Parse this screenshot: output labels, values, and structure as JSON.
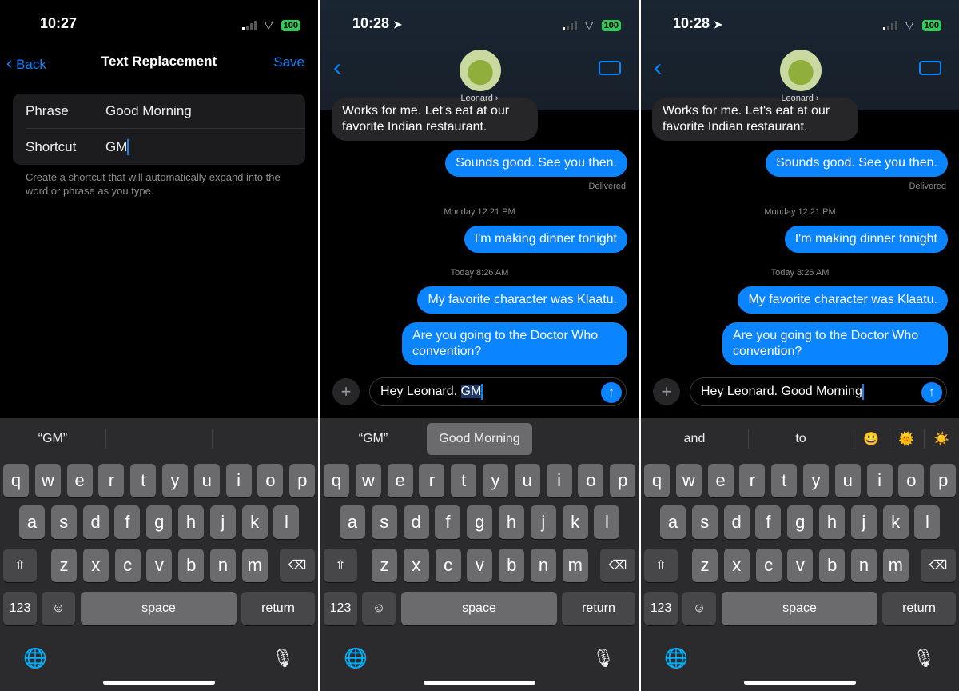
{
  "status": {
    "time_left": "10:27",
    "time_msgs": "10:28",
    "battery": "100"
  },
  "settings": {
    "back": "Back",
    "title": "Text Replacement",
    "save": "Save",
    "phrase_label": "Phrase",
    "phrase_value": "Good Morning",
    "shortcut_label": "Shortcut",
    "shortcut_value": "GM",
    "hint": "Create a shortcut that will automatically expand into the word or phrase as you type."
  },
  "messages": {
    "contact": "Leonard",
    "incoming": "Works for me. Let's eat at our favorite Indian restaurant.",
    "out1": "Sounds good. See you then.",
    "delivered": "Delivered",
    "ts1": "Monday 12:21 PM",
    "out2": "I'm making dinner tonight",
    "ts2": "Today 8:26 AM",
    "out3": "My favorite character was Klaatu.",
    "out4": "Are you going to the Doctor Who convention?"
  },
  "compose": {
    "prefix": "Hey Leonard. ",
    "typed": "GM",
    "replaced": "Good Morning"
  },
  "suggestions": {
    "p1": [
      "“GM”",
      "",
      ""
    ],
    "p2": [
      "“GM”",
      "Good Morning"
    ],
    "p3": [
      "and",
      "to",
      "😃",
      "🌞",
      "☀️"
    ]
  },
  "keyboard": {
    "rows": [
      [
        "q",
        "w",
        "e",
        "r",
        "t",
        "y",
        "u",
        "i",
        "o",
        "p"
      ],
      [
        "a",
        "s",
        "d",
        "f",
        "g",
        "h",
        "j",
        "k",
        "l"
      ],
      [
        "z",
        "x",
        "c",
        "v",
        "b",
        "n",
        "m"
      ]
    ],
    "shift": "⇧",
    "delete": "⌫",
    "numbers": "123",
    "emoji": "☺",
    "space": "space",
    "return": "return",
    "globe": "🌐",
    "mic": "🎙"
  },
  "colors": {
    "accent": "#0a84ff",
    "bubble_out": "#0a84ff",
    "bubble_in": "#262628",
    "keyboard_bg": "#2b2b2d"
  }
}
